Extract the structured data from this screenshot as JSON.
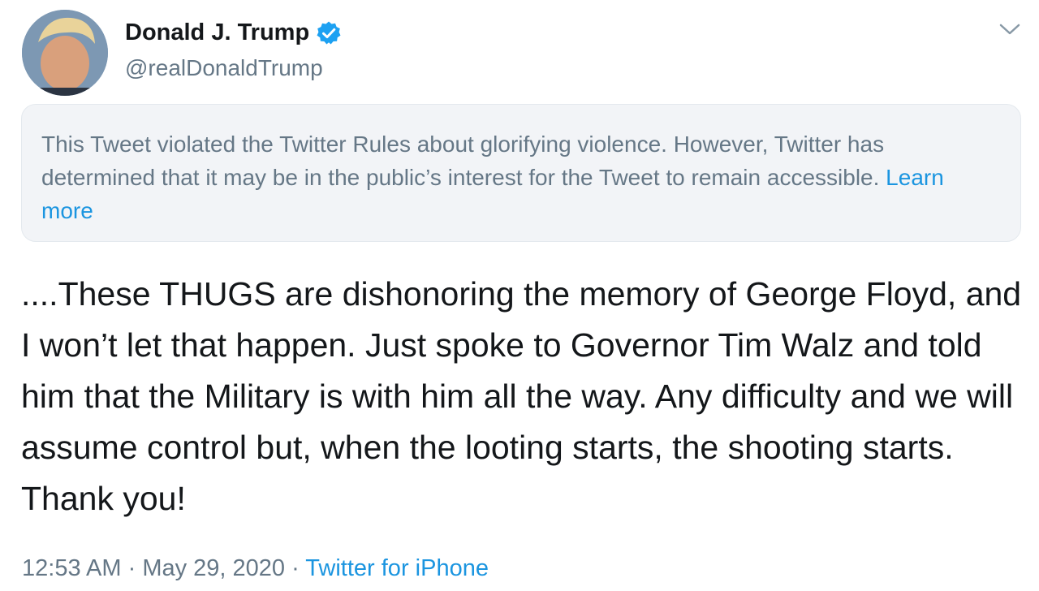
{
  "author": {
    "name": "Donald J. Trump",
    "handle": "@realDonaldTrump",
    "verified_icon": "verified-badge-icon",
    "avatar_icon": "profile-photo"
  },
  "menu": {
    "icon": "chevron-down-icon"
  },
  "notice": {
    "text": "This Tweet violated the Twitter Rules about glorifying violence. However, Twitter has determined that it may be in the public’s interest for the Tweet to remain accessible.",
    "link_label": "Learn more"
  },
  "tweet": {
    "text": "....These THUGS are dishonoring the memory of George Floyd, and I won’t let that happen. Just spoke to Governor Tim Walz and told him that the Military is with him all the way. Any difficulty and we will assume control but, when the looting starts, the shooting starts. Thank you!"
  },
  "meta": {
    "time": "12:53 AM",
    "separator": " · ",
    "date": "May 29, 2020",
    "source": "Twitter for iPhone"
  },
  "colors": {
    "link": "#1b95e0",
    "secondary_text": "#657786",
    "notice_bg": "#f2f4f7",
    "verified": "#1da1f2"
  }
}
